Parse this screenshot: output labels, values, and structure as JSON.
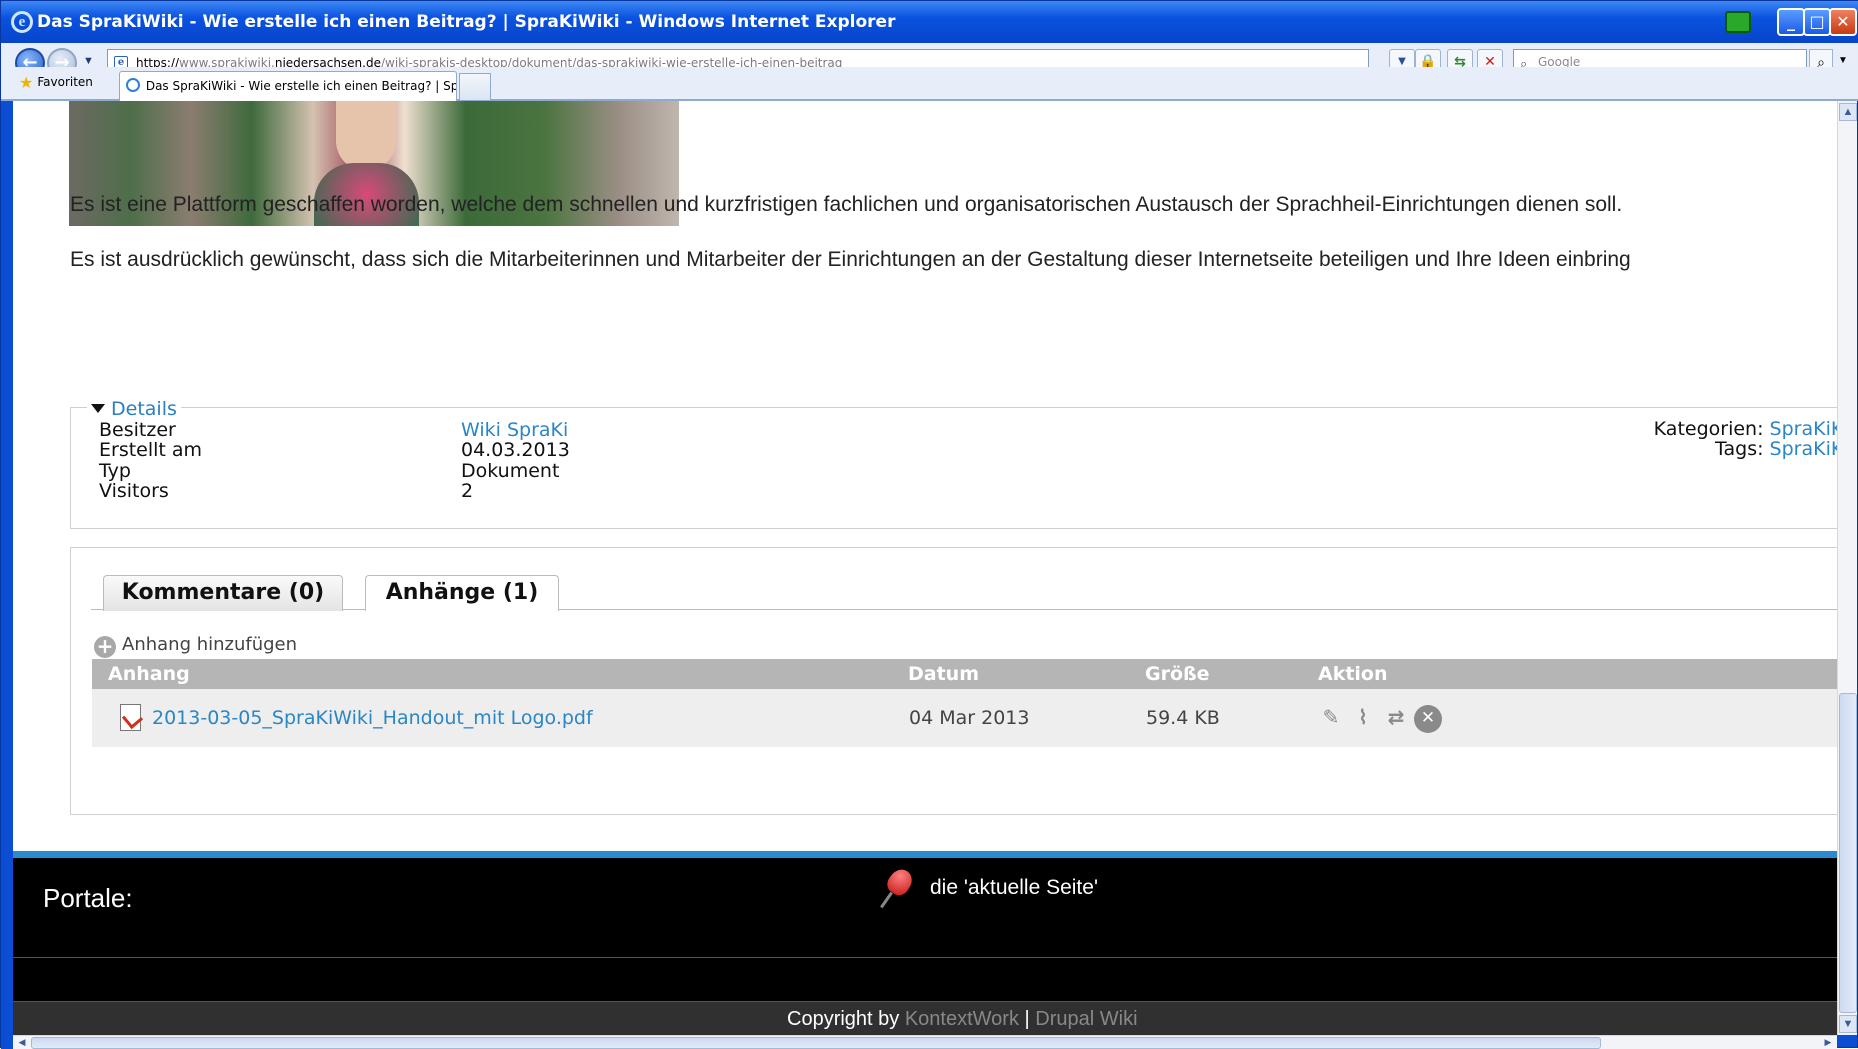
{
  "window": {
    "title": "Das SpraKiWiki - Wie erstelle ich einen Beitrag? | SpraKiWiki - Windows Internet Explorer",
    "minimize_label": "_",
    "maximize_label": "□",
    "close_label": "✕"
  },
  "addressbar": {
    "url_prefix": "https://",
    "url_sub": "www.sprakiwiki.",
    "url_domain": "niedersachsen.de",
    "url_path": "/wiki-sprakis-desktop/dokument/das-sprakiwiki-wie-erstelle-ich-einen-beitrag",
    "search_placeholder": "Google"
  },
  "tabsbar": {
    "favorites_label": "Favoriten",
    "active_tab_label": "Das SpraKiWiki - Wie erstelle ich einen Beitrag? | Spra..."
  },
  "article": {
    "paragraph1": "Es ist eine Plattform geschaffen worden, welche dem schnellen und kurzfristigen fachlichen und organisatorischen Austausch der Sprachheil-Einrichtungen dienen soll.",
    "paragraph2": "Es ist ausdrücklich gewünscht, dass sich die Mitarbeiterinnen und Mitarbeiter der Einrichtungen an der Gestaltung dieser Internetseite beteiligen und Ihre Ideen einbring"
  },
  "details": {
    "legend": "Details",
    "owner_label": "Besitzer",
    "owner_value": "Wiki SpraKi",
    "created_label": "Erstellt am",
    "created_value": "04.03.2013",
    "type_label": "Typ",
    "type_value": "Dokument",
    "visitors_label": "Visitors",
    "visitors_value": "2",
    "categories_label": "Kategorien:",
    "categories_value": "SpraKiKo",
    "tags_label": "Tags:",
    "tags_value": "SpraKiKo"
  },
  "tabs": {
    "comments_label": "Kommentare (0)",
    "attachments_label": "Anhänge (1)"
  },
  "attachments": {
    "add_label": "Anhang hinzufügen",
    "columns": [
      "Anhang",
      "Datum",
      "Größe",
      "Aktion"
    ],
    "rows": [
      {
        "name": "2013-03-05_SpraKiWiki_Handout_mit Logo.pdf",
        "date": "04 Mar 2013",
        "size": "59.4 KB"
      }
    ]
  },
  "footer": {
    "portale_label": "Portale:",
    "current_page_label": "die 'aktuelle Seite'",
    "copyright_prefix": "Copyright by",
    "copyright_link1": "KontextWork",
    "copyright_sep": "|",
    "copyright_link2": "Drupal Wiki"
  },
  "colors": {
    "link": "#2a86c6",
    "footer_bg": "#000000",
    "accent_bar": "#2b8bd0",
    "titlebar": "#0a52e0"
  }
}
